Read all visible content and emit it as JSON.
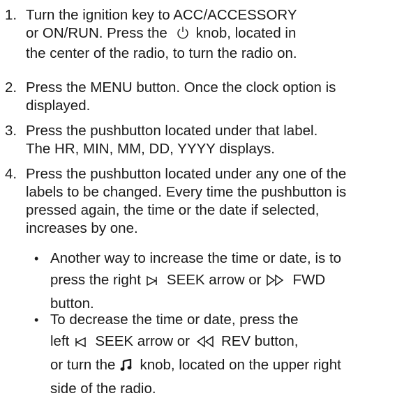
{
  "steps": [
    {
      "number": "1.",
      "lines": [
        "Turn the ignition key to ACC/ACCESSORY",
        "or ON/RUN. Press the",
        "knob, located in",
        "the center of the radio, to turn the radio on."
      ]
    },
    {
      "number": "2.",
      "lines": [
        "Press the MENU button. Once the clock option is",
        "displayed."
      ]
    },
    {
      "number": "3.",
      "lines": [
        "Press the pushbutton located under that label.",
        "The HR, MIN, MM, DD, YYYY displays."
      ]
    },
    {
      "number": "4.",
      "lines": [
        "Press the pushbutton located under any one of the",
        "labels to be changed. Every time the pushbutton is",
        "pressed again, the time or the date if selected,",
        "increases by one."
      ]
    }
  ],
  "bullets": [
    {
      "symbol": "•",
      "parts": [
        "Another way to increase the time or date, is to",
        "press the right",
        "SEEK arrow or",
        "FWD",
        "button."
      ]
    },
    {
      "symbol": "•",
      "parts": [
        "To decrease the time or date, press the",
        "left",
        "SEEK arrow or",
        "REV button,",
        "or turn the",
        "knob, located on the upper right",
        "side of the radio."
      ]
    }
  ],
  "icons": {
    "power": "power-icon",
    "seek_right": "seek-right-icon",
    "fwd": "fast-forward-icon",
    "seek_left": "seek-left-icon",
    "rev": "rewind-icon",
    "tune": "music-note-icon"
  }
}
